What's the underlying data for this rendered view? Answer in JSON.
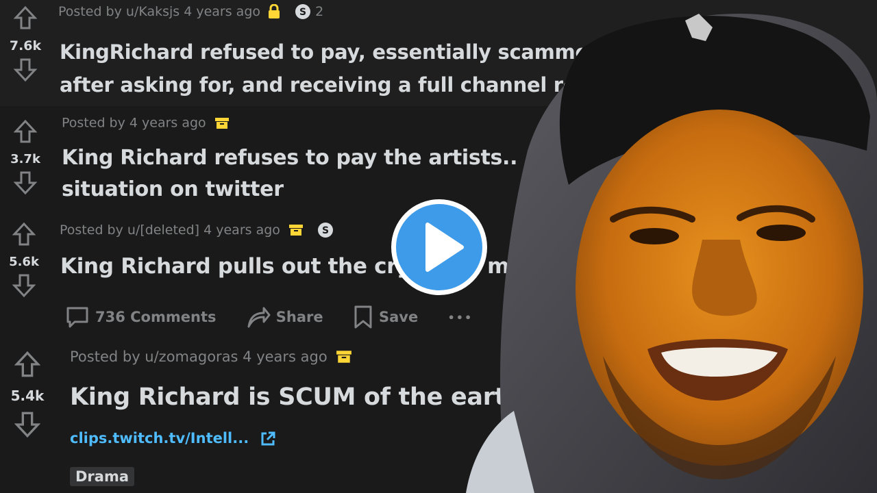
{
  "posts": [
    {
      "score": "7.6k",
      "meta": "Posted by u/Kaksjs 4 years ago",
      "lock_icon": "lock-icon",
      "award_count": "2",
      "title_lines": [
        "KingRichard refused to pay, essentially scammed",
        "after asking for, and receiving a full channel rel"
      ]
    },
    {
      "score": "3.7k",
      "meta": "Posted by 4 years ago",
      "title_lines": [
        "King Richard refuses to pay the artists..",
        "situation on twitter"
      ]
    },
    {
      "score": "5.6k",
      "meta": "Posted by u/[deleted] 4 years ago",
      "title_lines": [
        "King Richard pulls out the cry",
        "m"
      ]
    },
    {
      "score": "5.4k",
      "meta": "Posted by u/zomagoras 4 years ago",
      "title_lines": [
        "King Richard is SCUM of the earth"
      ],
      "link": "clips.twitch.tv/Intell...",
      "flair": "Drama"
    }
  ],
  "actions": {
    "comments": "736 Comments",
    "share": "Share",
    "save": "Save",
    "more": "•••"
  },
  "colors": {
    "background": "#1a1a1b",
    "meta": "#818384",
    "text": "#d7dadc",
    "link": "#4fbcff",
    "archive": "#ffd635",
    "play": "#3d9be9"
  }
}
